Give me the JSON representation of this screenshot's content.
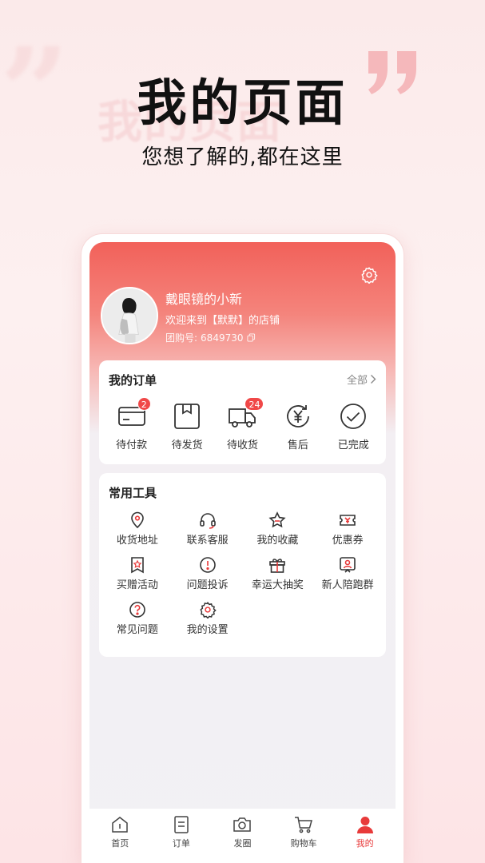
{
  "hero": {
    "title": "我的页面",
    "subtitle": "您想了解的,都在这里"
  },
  "profile": {
    "name": "戴眼镜的小新",
    "welcome": "欢迎来到【默默】的店铺",
    "group_label": "团购号:",
    "group_no": "6849730",
    "settings_icon": "gear-icon",
    "copy_icon": "copy-icon"
  },
  "orders": {
    "title": "我的订单",
    "all_label": "全部",
    "items": [
      {
        "label": "待付款",
        "icon": "wallet-card-icon",
        "badge": "2"
      },
      {
        "label": "待发货",
        "icon": "package-box-icon",
        "badge": ""
      },
      {
        "label": "待收货",
        "icon": "delivery-truck-icon",
        "badge": "24"
      },
      {
        "label": "售后",
        "icon": "yen-refresh-icon",
        "badge": ""
      },
      {
        "label": "已完成",
        "icon": "check-circle-icon",
        "badge": ""
      }
    ]
  },
  "tools": {
    "title": "常用工具",
    "items": [
      {
        "label": "收货地址",
        "icon": "location-pin-icon"
      },
      {
        "label": "联系客服",
        "icon": "headset-icon"
      },
      {
        "label": "我的收藏",
        "icon": "star-icon"
      },
      {
        "label": "优惠券",
        "icon": "coupon-icon"
      },
      {
        "label": "买赠活动",
        "icon": "gift-ribbon-icon"
      },
      {
        "label": "问题投诉",
        "icon": "exclamation-circle-icon"
      },
      {
        "label": "幸运大抽奖",
        "icon": "gift-box-icon"
      },
      {
        "label": "新人陪跑群",
        "icon": "group-person-icon"
      },
      {
        "label": "常见问题",
        "icon": "question-circle-icon"
      },
      {
        "label": "我的设置",
        "icon": "gear-icon"
      }
    ]
  },
  "tabbar": {
    "items": [
      {
        "label": "首页",
        "icon": "home-icon",
        "active": false
      },
      {
        "label": "订单",
        "icon": "order-list-icon",
        "active": false
      },
      {
        "label": "发圈",
        "icon": "camera-icon",
        "active": false
      },
      {
        "label": "购物车",
        "icon": "cart-icon",
        "active": false
      },
      {
        "label": "我的",
        "icon": "user-icon",
        "active": true
      }
    ]
  },
  "colors": {
    "accent": "#e83a3a",
    "header_red": "#f2615a",
    "badge": "#f04848"
  }
}
